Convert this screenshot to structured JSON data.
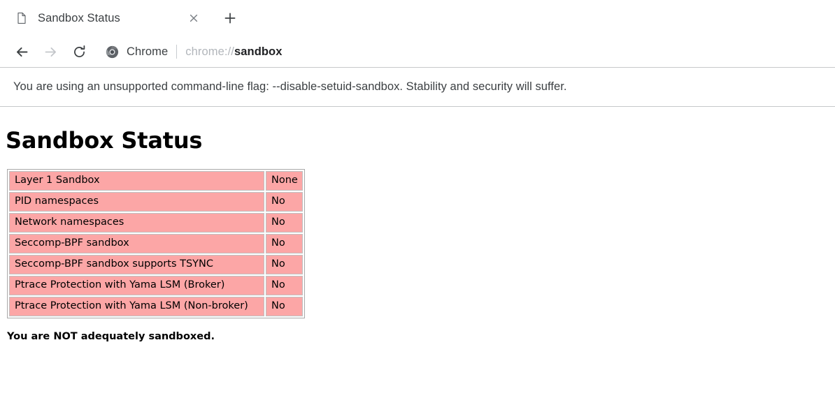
{
  "browser": {
    "tab": {
      "favicon_icon": "page-document-icon",
      "title": "Sandbox Status",
      "close_icon": "close-icon"
    },
    "new_tab_icon": "plus-icon",
    "toolbar": {
      "back_icon": "arrow-left-icon",
      "forward_icon": "arrow-right-icon",
      "reload_icon": "reload-icon",
      "chrome_logo_icon": "chrome-logo-icon",
      "omnibox_chip_label": "Chrome",
      "url_scheme": "chrome://",
      "url_host": "sandbox"
    },
    "infobar": {
      "message": "You are using an unsupported command-line flag: --disable-setuid-sandbox. Stability and security will suffer."
    }
  },
  "page": {
    "title": "Sandbox Status",
    "verdict": "You are NOT adequately sandboxed.",
    "colors": {
      "bad_cell_bg": "#fca6a6",
      "cell_border": "#c0c0c0",
      "table_border": "#a9a9a9"
    },
    "table": {
      "rows": [
        {
          "label": "Layer 1 Sandbox",
          "value": "None"
        },
        {
          "label": "PID namespaces",
          "value": "No"
        },
        {
          "label": "Network namespaces",
          "value": "No"
        },
        {
          "label": "Seccomp-BPF sandbox",
          "value": "No"
        },
        {
          "label": "Seccomp-BPF sandbox supports TSYNC",
          "value": "No"
        },
        {
          "label": "Ptrace Protection with Yama LSM (Broker)",
          "value": "No"
        },
        {
          "label": "Ptrace Protection with Yama LSM (Non-broker)",
          "value": "No"
        }
      ]
    }
  }
}
